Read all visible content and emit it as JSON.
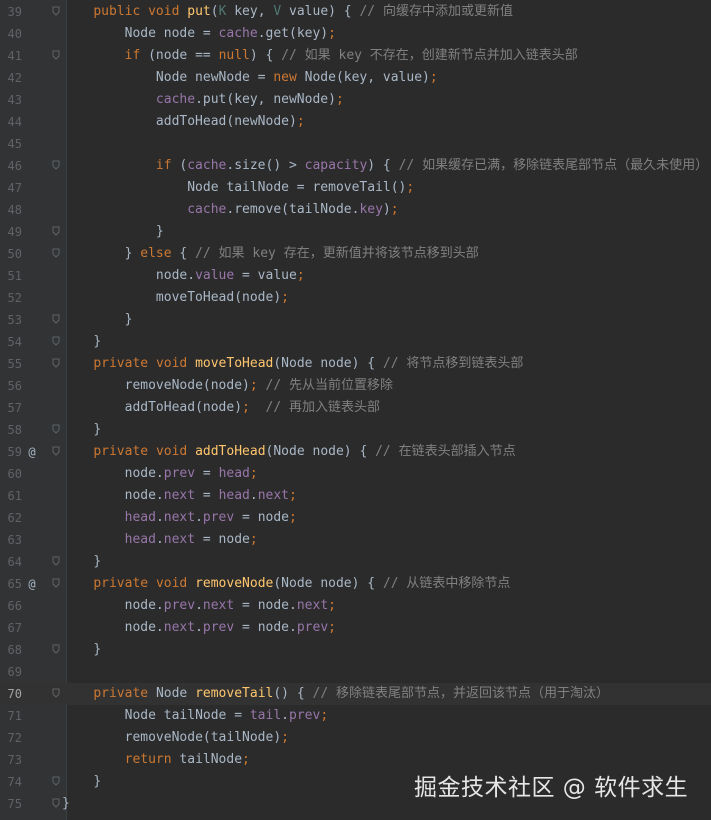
{
  "editor": {
    "current_line": "70",
    "lines": [
      {
        "n": "39",
        "mark": "",
        "fold": true,
        "indent": "    ",
        "tokens": [
          [
            "kw",
            "public "
          ],
          [
            "kw",
            "void "
          ],
          [
            "fn",
            "put"
          ],
          [
            "p",
            "("
          ],
          [
            "tp",
            "K"
          ],
          [
            "p",
            " key, "
          ],
          [
            "tp",
            "V"
          ],
          [
            "p",
            " value) { "
          ],
          [
            "cm",
            "// 向缓存中添加或更新值"
          ]
        ]
      },
      {
        "n": "40",
        "mark": "",
        "fold": false,
        "indent": "        ",
        "tokens": [
          [
            "p",
            "Node node = "
          ],
          [
            "fld",
            "cache"
          ],
          [
            "p",
            ".get(key)"
          ],
          [
            "kw",
            ";"
          ]
        ]
      },
      {
        "n": "41",
        "mark": "",
        "fold": true,
        "indent": "        ",
        "tokens": [
          [
            "kw",
            "if "
          ],
          [
            "p",
            "(node == "
          ],
          [
            "kw",
            "null"
          ],
          [
            "p",
            ") { "
          ],
          [
            "cm",
            "// 如果 key 不存在，创建新节点并加入链表头部"
          ]
        ]
      },
      {
        "n": "42",
        "mark": "",
        "fold": false,
        "indent": "            ",
        "tokens": [
          [
            "p",
            "Node newNode = "
          ],
          [
            "kw",
            "new "
          ],
          [
            "p",
            "Node(key, value)"
          ],
          [
            "kw",
            ";"
          ]
        ]
      },
      {
        "n": "43",
        "mark": "",
        "fold": false,
        "indent": "            ",
        "tokens": [
          [
            "fld",
            "cache"
          ],
          [
            "p",
            ".put(key, newNode)"
          ],
          [
            "kw",
            ";"
          ]
        ]
      },
      {
        "n": "44",
        "mark": "",
        "fold": false,
        "indent": "            ",
        "tokens": [
          [
            "p",
            "addToHead(newNode)"
          ],
          [
            "kw",
            ";"
          ]
        ]
      },
      {
        "n": "45",
        "mark": "",
        "fold": false,
        "indent": "",
        "tokens": []
      },
      {
        "n": "46",
        "mark": "",
        "fold": true,
        "indent": "            ",
        "tokens": [
          [
            "kw",
            "if "
          ],
          [
            "p",
            "("
          ],
          [
            "fld",
            "cache"
          ],
          [
            "p",
            ".size() > "
          ],
          [
            "fld",
            "capacity"
          ],
          [
            "p",
            ") { "
          ],
          [
            "cm",
            "// 如果缓存已满，移除链表尾部节点（最久未使用）"
          ]
        ]
      },
      {
        "n": "47",
        "mark": "",
        "fold": false,
        "indent": "                ",
        "tokens": [
          [
            "p",
            "Node tailNode = removeTail()"
          ],
          [
            "kw",
            ";"
          ]
        ]
      },
      {
        "n": "48",
        "mark": "",
        "fold": false,
        "indent": "                ",
        "tokens": [
          [
            "fld",
            "cache"
          ],
          [
            "p",
            ".remove(tailNode."
          ],
          [
            "fld",
            "key"
          ],
          [
            "p",
            ")"
          ],
          [
            "kw",
            ";"
          ]
        ]
      },
      {
        "n": "49",
        "mark": "",
        "fold": true,
        "indent": "            ",
        "tokens": [
          [
            "p",
            "}"
          ]
        ]
      },
      {
        "n": "50",
        "mark": "",
        "fold": true,
        "indent": "        ",
        "tokens": [
          [
            "p",
            "} "
          ],
          [
            "kw",
            "else "
          ],
          [
            "p",
            "{ "
          ],
          [
            "cm",
            "// 如果 key 存在，更新值并将该节点移到头部"
          ]
        ]
      },
      {
        "n": "51",
        "mark": "",
        "fold": false,
        "indent": "            ",
        "tokens": [
          [
            "p",
            "node."
          ],
          [
            "fld",
            "value"
          ],
          [
            "p",
            " = value"
          ],
          [
            "kw",
            ";"
          ]
        ]
      },
      {
        "n": "52",
        "mark": "",
        "fold": false,
        "indent": "            ",
        "tokens": [
          [
            "p",
            "moveToHead(node)"
          ],
          [
            "kw",
            ";"
          ]
        ]
      },
      {
        "n": "53",
        "mark": "",
        "fold": true,
        "indent": "        ",
        "tokens": [
          [
            "p",
            "}"
          ]
        ]
      },
      {
        "n": "54",
        "mark": "",
        "fold": true,
        "indent": "    ",
        "tokens": [
          [
            "p",
            "}"
          ]
        ]
      },
      {
        "n": "55",
        "mark": "",
        "fold": true,
        "indent": "    ",
        "tokens": [
          [
            "kw",
            "private "
          ],
          [
            "kw",
            "void "
          ],
          [
            "fn",
            "moveToHead"
          ],
          [
            "p",
            "(Node node) { "
          ],
          [
            "cm",
            "// 将节点移到链表头部"
          ]
        ]
      },
      {
        "n": "56",
        "mark": "",
        "fold": false,
        "indent": "        ",
        "tokens": [
          [
            "p",
            "removeNode(node)"
          ],
          [
            "kw",
            "; "
          ],
          [
            "cm",
            "// 先从当前位置移除"
          ]
        ]
      },
      {
        "n": "57",
        "mark": "",
        "fold": false,
        "indent": "        ",
        "tokens": [
          [
            "p",
            "addToHead(node)"
          ],
          [
            "kw",
            ";  "
          ],
          [
            "cm",
            "// 再加入链表头部"
          ]
        ]
      },
      {
        "n": "58",
        "mark": "",
        "fold": true,
        "indent": "    ",
        "tokens": [
          [
            "p",
            "}"
          ]
        ]
      },
      {
        "n": "59",
        "mark": "@",
        "fold": true,
        "indent": "    ",
        "tokens": [
          [
            "kw",
            "private "
          ],
          [
            "kw",
            "void "
          ],
          [
            "fn",
            "addToHead"
          ],
          [
            "p",
            "(Node node) { "
          ],
          [
            "cm",
            "// 在链表头部插入节点"
          ]
        ]
      },
      {
        "n": "60",
        "mark": "",
        "fold": false,
        "indent": "        ",
        "tokens": [
          [
            "p",
            "node."
          ],
          [
            "fld",
            "prev"
          ],
          [
            "p",
            " = "
          ],
          [
            "fld",
            "head"
          ],
          [
            "kw",
            ";"
          ]
        ]
      },
      {
        "n": "61",
        "mark": "",
        "fold": false,
        "indent": "        ",
        "tokens": [
          [
            "p",
            "node."
          ],
          [
            "fld",
            "next"
          ],
          [
            "p",
            " = "
          ],
          [
            "fld",
            "head"
          ],
          [
            "p",
            "."
          ],
          [
            "fld",
            "next"
          ],
          [
            "kw",
            ";"
          ]
        ]
      },
      {
        "n": "62",
        "mark": "",
        "fold": false,
        "indent": "        ",
        "tokens": [
          [
            "fld",
            "head"
          ],
          [
            "p",
            "."
          ],
          [
            "fld",
            "next"
          ],
          [
            "p",
            "."
          ],
          [
            "fld",
            "prev"
          ],
          [
            "p",
            " = node"
          ],
          [
            "kw",
            ";"
          ]
        ]
      },
      {
        "n": "63",
        "mark": "",
        "fold": false,
        "indent": "        ",
        "tokens": [
          [
            "fld",
            "head"
          ],
          [
            "p",
            "."
          ],
          [
            "fld",
            "next"
          ],
          [
            "p",
            " = node"
          ],
          [
            "kw",
            ";"
          ]
        ]
      },
      {
        "n": "64",
        "mark": "",
        "fold": true,
        "indent": "    ",
        "tokens": [
          [
            "p",
            "}"
          ]
        ]
      },
      {
        "n": "65",
        "mark": "@",
        "fold": true,
        "indent": "    ",
        "tokens": [
          [
            "kw",
            "private "
          ],
          [
            "kw",
            "void "
          ],
          [
            "fn",
            "removeNode"
          ],
          [
            "p",
            "(Node node) { "
          ],
          [
            "cm",
            "// 从链表中移除节点"
          ]
        ]
      },
      {
        "n": "66",
        "mark": "",
        "fold": false,
        "indent": "        ",
        "tokens": [
          [
            "p",
            "node."
          ],
          [
            "fld",
            "prev"
          ],
          [
            "p",
            "."
          ],
          [
            "fld",
            "next"
          ],
          [
            "p",
            " = node."
          ],
          [
            "fld",
            "next"
          ],
          [
            "kw",
            ";"
          ]
        ]
      },
      {
        "n": "67",
        "mark": "",
        "fold": false,
        "indent": "        ",
        "tokens": [
          [
            "p",
            "node."
          ],
          [
            "fld",
            "next"
          ],
          [
            "p",
            "."
          ],
          [
            "fld",
            "prev"
          ],
          [
            "p",
            " = node."
          ],
          [
            "fld",
            "prev"
          ],
          [
            "kw",
            ";"
          ]
        ]
      },
      {
        "n": "68",
        "mark": "",
        "fold": true,
        "indent": "    ",
        "tokens": [
          [
            "p",
            "}"
          ]
        ]
      },
      {
        "n": "69",
        "mark": "",
        "fold": false,
        "indent": "",
        "tokens": []
      },
      {
        "n": "70",
        "mark": "",
        "fold": true,
        "indent": "    ",
        "tokens": [
          [
            "kw",
            "private "
          ],
          [
            "p",
            "Node "
          ],
          [
            "fn",
            "removeTail"
          ],
          [
            "p",
            "() { "
          ],
          [
            "cm",
            "// 移除链表尾部节点，并返回该节点（用于淘汰）"
          ]
        ]
      },
      {
        "n": "71",
        "mark": "",
        "fold": false,
        "indent": "        ",
        "tokens": [
          [
            "p",
            "Node tailNode = "
          ],
          [
            "fld",
            "tail"
          ],
          [
            "p",
            "."
          ],
          [
            "fld",
            "prev"
          ],
          [
            "kw",
            ";"
          ]
        ]
      },
      {
        "n": "72",
        "mark": "",
        "fold": false,
        "indent": "        ",
        "tokens": [
          [
            "p",
            "removeNode(tailNode)"
          ],
          [
            "kw",
            ";"
          ]
        ]
      },
      {
        "n": "73",
        "mark": "",
        "fold": false,
        "indent": "        ",
        "tokens": [
          [
            "kw",
            "return "
          ],
          [
            "p",
            "tailNode"
          ],
          [
            "kw",
            ";"
          ]
        ]
      },
      {
        "n": "74",
        "mark": "",
        "fold": true,
        "indent": "    ",
        "tokens": [
          [
            "p",
            "}"
          ]
        ]
      },
      {
        "n": "75",
        "mark": "",
        "fold": true,
        "indent": "",
        "tokens": [
          [
            "p",
            "}"
          ]
        ]
      }
    ]
  },
  "watermark": "掘金技术社区 @ 软件求生",
  "colors": {
    "background": "#2b2b2b",
    "gutter": "#313335",
    "keyword": "#cc7832",
    "method": "#ffc66d",
    "field": "#9876aa",
    "comment": "#808080",
    "plain": "#a9b7c6"
  },
  "icons": {
    "override_marker": "at-sign-icon",
    "fold_marker": "fold-icon"
  }
}
